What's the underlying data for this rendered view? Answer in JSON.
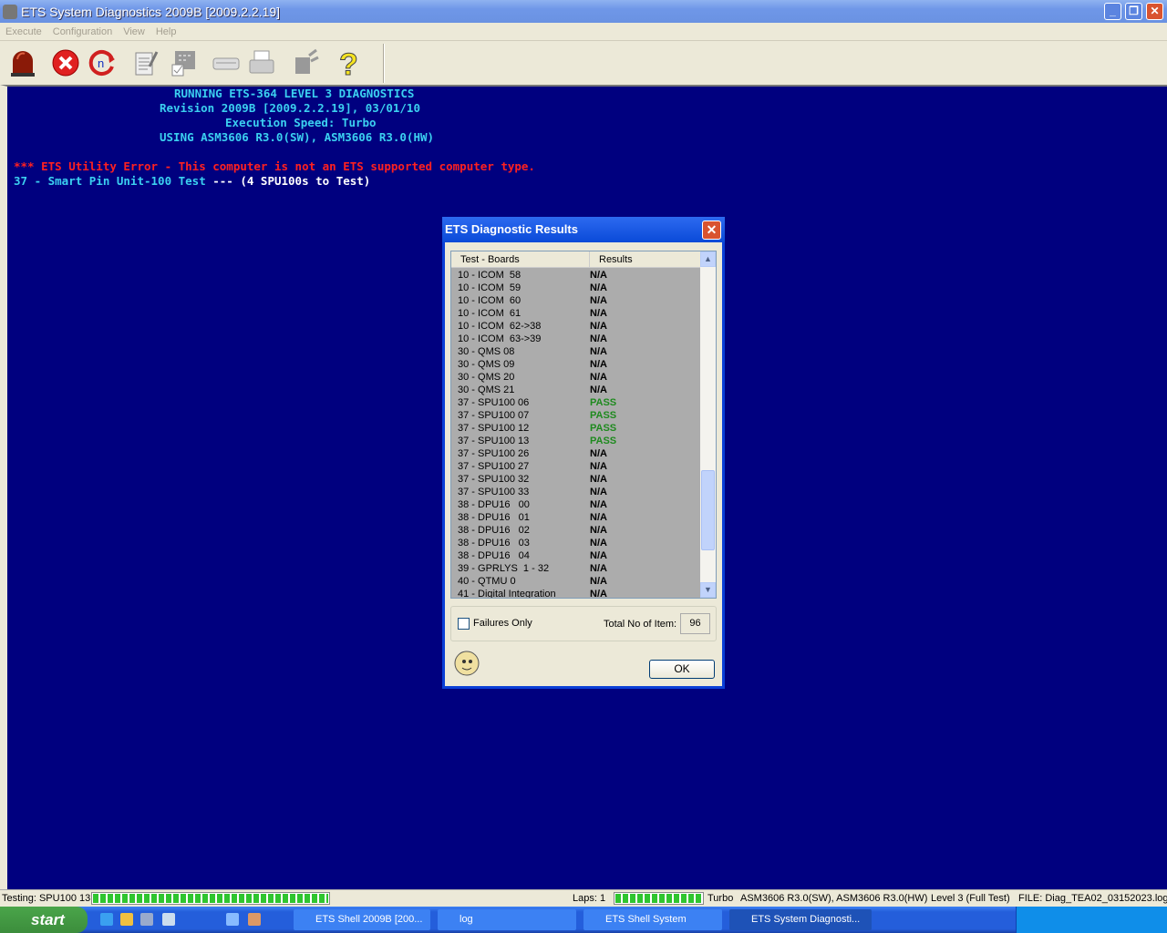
{
  "window": {
    "title": "ETS System Diagnostics 2009B [2009.2.2.19]"
  },
  "menu": [
    "Execute",
    "Configuration",
    "View",
    "Help"
  ],
  "toolbar": {
    "icons": [
      "alarm-light-icon",
      "stop-icon",
      "repeat-n-icon",
      "edit-notes-icon",
      "select-grid-icon",
      "card-reader-icon",
      "printer-icon",
      "hand-icon",
      "help-icon"
    ]
  },
  "console": {
    "lines": [
      "RUNNING ETS-364 LEVEL 3 DIAGNOSTICS",
      "Revision 2009B [2009.2.2.19], 03/01/10",
      "Execution Speed: Turbo",
      "USING ASM3606 R3.0(SW), ASM3606 R3.0(HW)"
    ],
    "error": "*** ETS Utility Error - This computer is not an ETS supported computer type.",
    "test_line": "37 - Smart Pin Unit-100 Test",
    "test_suffix": " --- (4 SPU100s to Test)",
    "colors": {
      "text": "#3bd0f0",
      "error": "#ff2020",
      "background": "#00007f"
    }
  },
  "dialog": {
    "title": "ETS Diagnostic Results",
    "columns": [
      "Test - Boards",
      "Results"
    ],
    "rows": [
      [
        "10 - ICOM  58",
        "N/A"
      ],
      [
        "10 - ICOM  59",
        "N/A"
      ],
      [
        "10 - ICOM  60",
        "N/A"
      ],
      [
        "10 - ICOM  61",
        "N/A"
      ],
      [
        "10 - ICOM  62->38",
        "N/A"
      ],
      [
        "10 - ICOM  63->39",
        "N/A"
      ],
      [
        "30 - QMS 08",
        "N/A"
      ],
      [
        "30 - QMS 09",
        "N/A"
      ],
      [
        "30 - QMS 20",
        "N/A"
      ],
      [
        "30 - QMS 21",
        "N/A"
      ],
      [
        "37 - SPU100 06",
        "PASS"
      ],
      [
        "37 - SPU100 07",
        "PASS"
      ],
      [
        "37 - SPU100 12",
        "PASS"
      ],
      [
        "37 - SPU100 13",
        "PASS"
      ],
      [
        "37 - SPU100 26",
        "N/A"
      ],
      [
        "37 - SPU100 27",
        "N/A"
      ],
      [
        "37 - SPU100 32",
        "N/A"
      ],
      [
        "37 - SPU100 33",
        "N/A"
      ],
      [
        "38 - DPU16   00",
        "N/A"
      ],
      [
        "38 - DPU16   01",
        "N/A"
      ],
      [
        "38 - DPU16   02",
        "N/A"
      ],
      [
        "38 - DPU16   03",
        "N/A"
      ],
      [
        "38 - DPU16   04",
        "N/A"
      ],
      [
        "39 - GPRLYS  1 - 32",
        "N/A"
      ],
      [
        "40 - QTMU 0",
        "N/A"
      ],
      [
        "41 - Digital Integration",
        "N/A"
      ]
    ],
    "failures_only_label": "Failures Only",
    "failures_only_checked": false,
    "total_label": "Total No of Item:",
    "total_value": "96",
    "ok_label": "OK",
    "pass_color": "#1e8a1e"
  },
  "status": {
    "testing": "Testing: SPU100 13",
    "testing_progress": 1.0,
    "laps": "Laps: 1",
    "laps_progress": 1.0,
    "speed": "Turbo",
    "asm": "ASM3606 R3.0(SW), ASM3606 R3.0(HW)",
    "level": "Level 3 (Full Test)",
    "file": "FILE: Diag_TEA02_03152023.log"
  },
  "taskbar": {
    "start": "start",
    "tasks": [
      "ETS Shell 2009B [200...",
      "log",
      "ETS Shell System",
      "ETS System Diagnosti..."
    ]
  }
}
